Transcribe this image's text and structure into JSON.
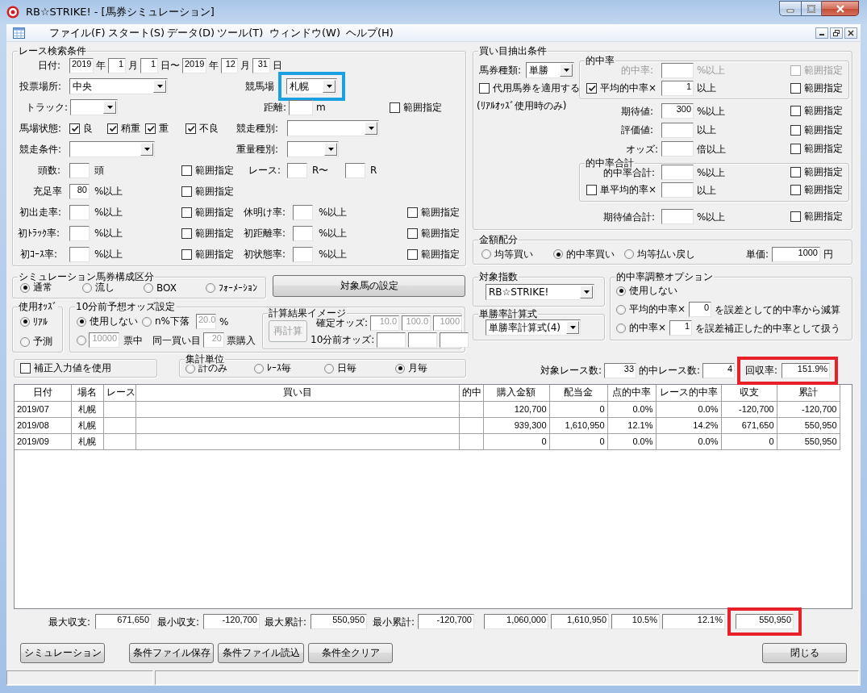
{
  "window": {
    "title": "RB☆STRIKE! - [馬券シミュレーション]"
  },
  "menu": [
    "ファイル(F)",
    "スタート(S)",
    "データ(D)",
    "ツール(T)",
    "ウィンドウ(W)",
    "ヘルプ(H)"
  ],
  "race_search": {
    "title": "レース検索条件",
    "rows": [
      {
        "items": [
          {
            "kind": "label",
            "text": "日付:"
          },
          {
            "kind": "field",
            "value": "2019"
          },
          {
            "kind": "label",
            "text": "年"
          },
          {
            "kind": "field",
            "value": "1"
          },
          {
            "kind": "label",
            "text": "月"
          },
          {
            "kind": "field",
            "value": "1"
          },
          {
            "kind": "label",
            "text": "日〜"
          },
          {
            "kind": "field",
            "value": "2019"
          },
          {
            "kind": "label",
            "text": "年"
          },
          {
            "kind": "field",
            "value": "12"
          },
          {
            "kind": "label",
            "text": "月"
          },
          {
            "kind": "field",
            "value": "31"
          },
          {
            "kind": "label",
            "text": "日"
          }
        ]
      },
      {
        "items": [
          {
            "kind": "label",
            "text": "投票場所:"
          },
          {
            "kind": "combo",
            "value": "中央"
          },
          {
            "kind": "label",
            "text": "競馬場"
          },
          {
            "kind": "frame",
            "color": "#1ba1e2",
            "items": [
              {
                "kind": "combo",
                "value": "札幌"
              }
            ]
          }
        ]
      },
      {
        "items": [
          {
            "kind": "label",
            "text": "トラック:"
          },
          {
            "kind": "combo"
          },
          {
            "kind": "label",
            "text": "距離:"
          },
          {
            "kind": "field"
          },
          {
            "kind": "label",
            "text": "m"
          },
          {
            "kind": "check",
            "label": "範囲指定",
            "checked": false
          }
        ]
      },
      {
        "items": [
          {
            "kind": "label",
            "text": "馬場状態:"
          },
          {
            "kind": "check",
            "label": "良",
            "checked": true
          },
          {
            "kind": "check",
            "label": "稍重",
            "checked": true
          },
          {
            "kind": "check",
            "label": "重",
            "checked": true
          },
          {
            "kind": "check",
            "label": "不良",
            "checked": true
          },
          {
            "kind": "label",
            "text": "競走種別:"
          },
          {
            "kind": "combo"
          }
        ]
      },
      {
        "items": [
          {
            "kind": "label",
            "text": "競走条件:"
          },
          {
            "kind": "combo"
          },
          {
            "kind": "label",
            "text": "重量種別:"
          },
          {
            "kind": "combo"
          }
        ]
      },
      {
        "items": [
          {
            "kind": "label",
            "text": "頭数:"
          },
          {
            "kind": "field"
          },
          {
            "kind": "label",
            "text": "頭"
          },
          {
            "kind": "check",
            "label": "範囲指定",
            "checked": false
          },
          {
            "kind": "label",
            "text": "レース:"
          },
          {
            "kind": "field"
          },
          {
            "kind": "label",
            "text": "R〜"
          },
          {
            "kind": "field"
          },
          {
            "kind": "label",
            "text": "R"
          }
        ]
      },
      {
        "items": [
          {
            "kind": "label",
            "text": "充足率"
          },
          {
            "kind": "field",
            "value": "80"
          },
          {
            "kind": "label",
            "text": "%以上"
          },
          {
            "kind": "check",
            "label": "範囲指定",
            "checked": false
          }
        ]
      },
      {
        "items": [
          {
            "kind": "label",
            "text": "初出走率:"
          },
          {
            "kind": "field"
          },
          {
            "kind": "label",
            "text": "%以上"
          },
          {
            "kind": "check",
            "label": "範囲指定",
            "checked": false
          },
          {
            "kind": "label",
            "text": "休明け率:"
          },
          {
            "kind": "field"
          },
          {
            "kind": "label",
            "text": "%以上"
          },
          {
            "kind": "check",
            "label": "範囲指定",
            "checked": false
          }
        ]
      },
      {
        "items": [
          {
            "kind": "label",
            "text": "初ﾄﾗｯｸ率:"
          },
          {
            "kind": "field"
          },
          {
            "kind": "label",
            "text": "%以上"
          },
          {
            "kind": "check",
            "label": "範囲指定",
            "checked": false
          },
          {
            "kind": "label",
            "text": "初距離率:"
          },
          {
            "kind": "field"
          },
          {
            "kind": "label",
            "text": "%以上"
          },
          {
            "kind": "check",
            "label": "範囲指定",
            "checked": false
          }
        ]
      },
      {
        "items": [
          {
            "kind": "label",
            "text": "初ｺｰｽ率:"
          },
          {
            "kind": "field"
          },
          {
            "kind": "label",
            "text": "%以上"
          },
          {
            "kind": "check",
            "label": "範囲指定",
            "checked": false
          },
          {
            "kind": "label",
            "text": "初状態率:"
          },
          {
            "kind": "field"
          },
          {
            "kind": "label",
            "text": "%以上"
          },
          {
            "kind": "check",
            "label": "範囲指定",
            "checked": false
          }
        ]
      }
    ]
  },
  "bet_extraction": {
    "title": "買い目抽出条件",
    "left_rows": [
      {
        "items": [
          {
            "kind": "label",
            "text": "馬券種類:"
          },
          {
            "kind": "combo",
            "value": "単勝"
          }
        ]
      },
      {
        "items": [
          {
            "kind": "check",
            "label": "代用馬券を適用する",
            "checked": false
          }
        ]
      },
      {
        "items": [
          {
            "kind": "label",
            "text": "(ﾘｱﾙｵｯｽﾞ使用時のみ)"
          }
        ]
      }
    ],
    "hit_rate": {
      "title": "的中率",
      "rows": [
        {
          "items": [
            {
              "kind": "label",
              "text": "的中率:",
              "disabled": true
            },
            {
              "kind": "field",
              "disabled": true
            },
            {
              "kind": "label",
              "text": "%以上",
              "disabled": true
            },
            {
              "kind": "check",
              "label": "範囲指定",
              "checked": false,
              "disabled": true
            }
          ]
        },
        {
          "items": [
            {
              "kind": "check",
              "label": "平均的中率×",
              "checked": true
            },
            {
              "kind": "field",
              "value": "1"
            },
            {
              "kind": "label",
              "text": "以上"
            },
            {
              "kind": "check",
              "label": "範囲指定",
              "checked": false
            }
          ]
        }
      ]
    },
    "rows": [
      {
        "items": [
          {
            "kind": "label",
            "text": "期待値:"
          },
          {
            "kind": "field",
            "value": "300"
          },
          {
            "kind": "label",
            "text": "%以上"
          },
          {
            "kind": "check",
            "label": "範囲指定",
            "checked": false
          }
        ]
      },
      {
        "items": [
          {
            "kind": "label",
            "text": "評価値:"
          },
          {
            "kind": "field"
          },
          {
            "kind": "label",
            "text": "以上"
          },
          {
            "kind": "check",
            "label": "範囲指定",
            "checked": false
          }
        ]
      },
      {
        "items": [
          {
            "kind": "label",
            "text": "オッズ:"
          },
          {
            "kind": "field"
          },
          {
            "kind": "label",
            "text": "倍以上"
          },
          {
            "kind": "check",
            "label": "範囲指定",
            "checked": false
          }
        ]
      }
    ],
    "hit_rate_total": {
      "title": "的中率合計",
      "rows": [
        {
          "items": [
            {
              "kind": "label",
              "text": "的中率合計:"
            },
            {
              "kind": "field"
            },
            {
              "kind": "label",
              "text": "%以上"
            },
            {
              "kind": "check",
              "label": "範囲指定",
              "checked": false
            }
          ]
        },
        {
          "items": [
            {
              "kind": "check",
              "label": "単平均的率×",
              "checked": false
            },
            {
              "kind": "field"
            },
            {
              "kind": "label",
              "text": "以上"
            },
            {
              "kind": "check",
              "label": "範囲指定",
              "checked": false
            }
          ]
        }
      ]
    },
    "bottom_rows": [
      {
        "items": [
          {
            "kind": "label",
            "text": "期待値合計:"
          },
          {
            "kind": "field"
          },
          {
            "kind": "label",
            "text": "%以上"
          },
          {
            "kind": "check",
            "label": "範囲指定",
            "checked": false
          }
        ]
      }
    ]
  },
  "amount_allocation": {
    "title": "金額配分",
    "rows": [
      {
        "items": [
          {
            "kind": "radio",
            "label": "均等買い",
            "selected": false
          },
          {
            "kind": "radio",
            "label": "的中率買い",
            "selected": true
          },
          {
            "kind": "radio",
            "label": "均等払い戻し",
            "selected": false
          },
          {
            "kind": "label",
            "text": "単価:"
          },
          {
            "kind": "field",
            "value": "1000"
          },
          {
            "kind": "label",
            "text": "円"
          }
        ]
      }
    ]
  },
  "sim_type": {
    "title": "シミュレーション馬券構成区分",
    "rows": [
      {
        "items": [
          {
            "kind": "radio",
            "label": "通常",
            "selected": true
          },
          {
            "kind": "radio",
            "label": "流し",
            "selected": false
          },
          {
            "kind": "radio",
            "label": "BOX",
            "selected": false
          },
          {
            "kind": "radio",
            "label": "ﾌｫｰﾒｰｼｮﾝ",
            "selected": false
          }
        ]
      }
    ]
  },
  "target_horse_button": {
    "kind": "button",
    "label": "対象馬の設定"
  },
  "target_index": {
    "title": "対象指数",
    "rows": [
      {
        "items": [
          {
            "kind": "combo",
            "value": "RB☆STRIKE!"
          }
        ]
      }
    ]
  },
  "win_rate_formula": {
    "title": "単勝率計算式",
    "rows": [
      {
        "items": [
          {
            "kind": "combo",
            "value": "単勝率計算式(4)"
          }
        ]
      }
    ]
  },
  "hit_rate_adjust": {
    "title": "的中率調整オプション",
    "rows": [
      {
        "items": [
          {
            "kind": "radio",
            "label": "使用しない",
            "selected": true
          }
        ]
      },
      {
        "items": [
          {
            "kind": "radio",
            "label": "平均的中率×",
            "selected": false
          },
          {
            "kind": "field",
            "value": "0"
          },
          {
            "kind": "label",
            "text": "を誤差として的中率から減算"
          }
        ]
      },
      {
        "items": [
          {
            "kind": "radio",
            "label": "的中率×",
            "selected": false
          },
          {
            "kind": "field",
            "value": "1"
          },
          {
            "kind": "label",
            "text": "を誤差補正した的中率として扱う"
          }
        ]
      }
    ]
  },
  "odds_used": {
    "title": "使用ｵｯｽﾞ",
    "rows": [
      {
        "items": [
          {
            "kind": "radio",
            "label": "ﾘｱﾙ",
            "selected": true
          }
        ]
      },
      {
        "items": [
          {
            "kind": "radio",
            "label": "予測",
            "selected": false
          }
        ]
      }
    ]
  },
  "pre_odds": {
    "title": "10分前予想オッズ設定",
    "rows": [
      {
        "items": [
          {
            "kind": "radio",
            "label": "使用しない",
            "selected": true
          },
          {
            "kind": "radio",
            "label": "n%下落",
            "selected": false
          },
          {
            "kind": "field",
            "value": "20.0",
            "disabled": true
          },
          {
            "kind": "label",
            "text": "%"
          }
        ]
      },
      {
        "items": [
          {
            "kind": "radio",
            "selected": false
          },
          {
            "kind": "field",
            "value": "10000",
            "disabled": true
          },
          {
            "kind": "label",
            "text": "票中"
          },
          {
            "kind": "label",
            "text": "同一買い目"
          },
          {
            "kind": "field",
            "value": "20",
            "disabled": true
          },
          {
            "kind": "label",
            "text": "票購入"
          }
        ]
      }
    ],
    "calc_image": {
      "title": "計算結果イメージ",
      "recalc_button": {
        "kind": "button",
        "label": "再計算",
        "disabled": true
      },
      "rows": [
        {
          "items": [
            {
              "kind": "label",
              "text": "確定オッズ:"
            },
            {
              "kind": "field",
              "value": "10.0",
              "disabled": true
            },
            {
              "kind": "field",
              "value": "100.0",
              "disabled": true
            },
            {
              "kind": "field",
              "value": "1000",
              "disabled": true
            }
          ]
        },
        {
          "items": [
            {
              "kind": "label",
              "text": "10分前オッズ:"
            },
            {
              "kind": "field"
            },
            {
              "kind": "field"
            },
            {
              "kind": "field"
            }
          ]
        }
      ]
    }
  },
  "correction": {
    "rows": [
      {
        "items": [
          {
            "kind": "check",
            "label": "補正入力値を使用",
            "checked": false
          }
        ]
      }
    ]
  },
  "aggregation": {
    "title": "集計単位",
    "rows": [
      {
        "items": [
          {
            "kind": "radio",
            "label": "計のみ",
            "selected": false
          },
          {
            "kind": "radio",
            "label": "ﾚｰｽ毎",
            "selected": false
          },
          {
            "kind": "radio",
            "label": "日毎",
            "selected": false
          },
          {
            "kind": "radio",
            "label": "月毎",
            "selected": true
          }
        ]
      }
    ]
  },
  "summary": [
    {
      "kind": "label",
      "text": "対象レース数:"
    },
    {
      "kind": "field",
      "value": "33"
    },
    {
      "kind": "label",
      "text": "的中レース数:"
    },
    {
      "kind": "field",
      "value": "4"
    },
    {
      "kind": "frame",
      "color": "#e8202a",
      "items": [
        {
          "kind": "label",
          "text": "回収率:"
        },
        {
          "kind": "field",
          "value": "151.9%"
        }
      ]
    }
  ],
  "table": {
    "columns": [
      "日付",
      "場名",
      "レース",
      "買い目",
      "的中",
      "購入金額",
      "配当金",
      "点的中率",
      "レース的中率",
      "収支",
      "累計"
    ],
    "rows": [
      {
        "date": "2019/07",
        "venue": "札幌",
        "purchase": "120,700",
        "payout": "0",
        "point_hit_rate": "0.0%",
        "race_hit_rate": "0.0%",
        "balance": "-120,700",
        "cumulative": "-120,700"
      },
      {
        "date": "2019/08",
        "venue": "札幌",
        "purchase": "939,300",
        "payout": "1,610,950",
        "point_hit_rate": "12.1%",
        "race_hit_rate": "14.2%",
        "balance": "671,650",
        "cumulative": "550,950"
      },
      {
        "date": "2019/09",
        "venue": "札幌",
        "purchase": "0",
        "payout": "0",
        "point_hit_rate": "0.0%",
        "race_hit_rate": "0.0%",
        "balance": "0",
        "cumulative": "550,950"
      }
    ]
  },
  "totals": [
    {
      "kind": "label",
      "text": "最大収支:"
    },
    {
      "kind": "field",
      "value": "671,650"
    },
    {
      "kind": "label",
      "text": "最小収支:"
    },
    {
      "kind": "field",
      "value": "-120,700"
    },
    {
      "kind": "label",
      "text": "最大累計:"
    },
    {
      "kind": "field",
      "value": "550,950"
    },
    {
      "kind": "label",
      "text": "最小累計:"
    },
    {
      "kind": "field",
      "value": "-120,700"
    },
    {
      "kind": "field",
      "value": "1,060,000"
    },
    {
      "kind": "field",
      "value": "1,610,950"
    },
    {
      "kind": "field",
      "value": "10.5%"
    },
    {
      "kind": "field",
      "value": "12.1%"
    },
    {
      "kind": "frame",
      "color": "#e8202a",
      "items": [
        {
          "kind": "field",
          "value": "550,950"
        }
      ]
    }
  ],
  "buttons": [
    {
      "kind": "button",
      "label": "シミュレーション"
    },
    {
      "kind": "button",
      "label": "条件ファイル保存"
    },
    {
      "kind": "button",
      "label": "条件ファイル読込"
    },
    {
      "kind": "button",
      "label": "条件全クリア"
    },
    {
      "kind": "button",
      "label": "閉じる"
    }
  ]
}
